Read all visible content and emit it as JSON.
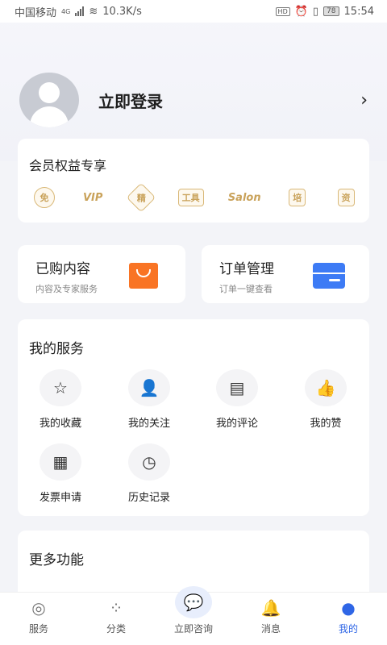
{
  "status_bar": {
    "carrier": "中国移动",
    "network": "4G",
    "speed": "10.3K/s",
    "hd": "HD",
    "battery": "78",
    "time": "15:54"
  },
  "login": {
    "label": "立即登录",
    "arrow": "›"
  },
  "member": {
    "title": "会员权益专享",
    "perks": [
      "免",
      "VIP",
      "精",
      "工具",
      "Salon",
      "培",
      "资"
    ]
  },
  "bought": {
    "title": "已购内容",
    "subtitle": "内容及专家服务"
  },
  "orders": {
    "title": "订单管理",
    "subtitle": "订单一键查看"
  },
  "services": {
    "title": "我的服务",
    "items": [
      {
        "label": "我的收藏",
        "icon": "☆"
      },
      {
        "label": "我的关注",
        "icon": "👤"
      },
      {
        "label": "我的评论",
        "icon": "▤"
      },
      {
        "label": "我的赞",
        "icon": "👍"
      },
      {
        "label": "发票申请",
        "icon": "▦"
      },
      {
        "label": "历史记录",
        "icon": "◷"
      }
    ]
  },
  "more": {
    "title": "更多功能"
  },
  "bottom_nav": [
    {
      "label": "服务",
      "icon": "◎"
    },
    {
      "label": "分类",
      "icon": "⁘"
    },
    {
      "label": "立即咨询",
      "icon": "💬"
    },
    {
      "label": "消息",
      "icon": "🔔"
    },
    {
      "label": "我的",
      "icon": "●"
    }
  ],
  "colors": {
    "accent": "#2f66e6",
    "gold": "#c9a25a",
    "orange": "#f97424",
    "blue": "#3d7bf5"
  }
}
